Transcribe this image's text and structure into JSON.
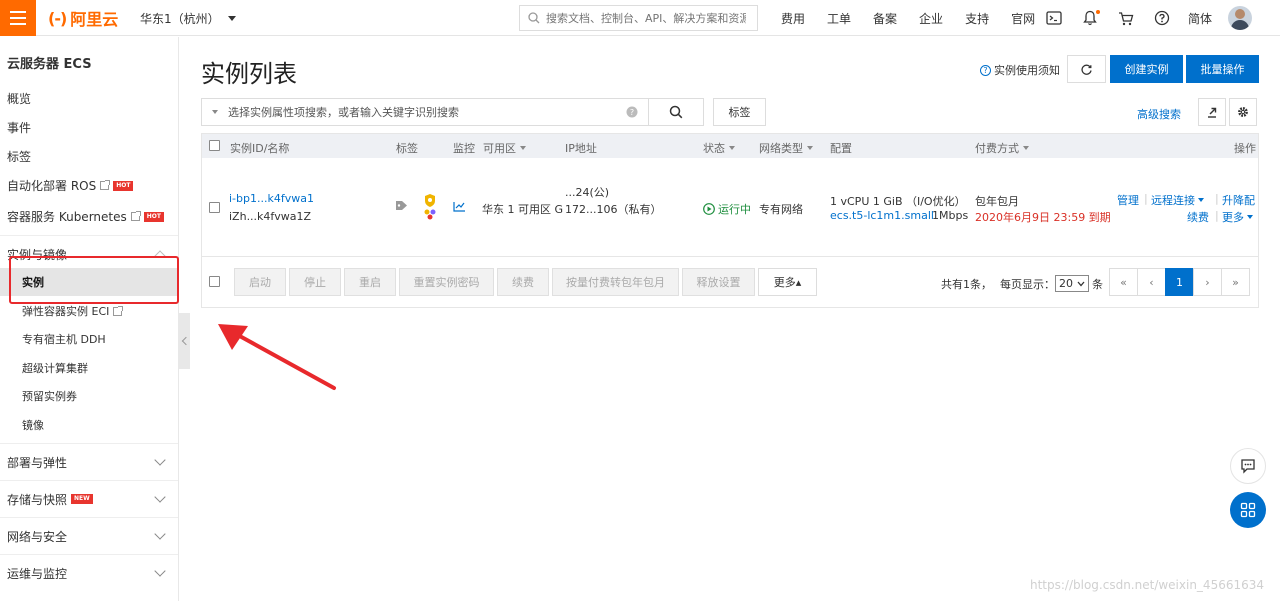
{
  "topbar": {
    "logo_mark": "(-)",
    "logo_text": "阿里云",
    "region": "华东1（杭州）",
    "search_placeholder": "搜索文档、控制台、API、解决方案和资源",
    "nav": [
      "费用",
      "工单",
      "备案",
      "企业",
      "支持",
      "官网"
    ],
    "language": "简体",
    "icons": [
      "terminal-icon",
      "bell-icon",
      "cart-icon",
      "help-icon"
    ]
  },
  "sidebar": {
    "title": "云服务器 ECS",
    "items": [
      {
        "label": "概览"
      },
      {
        "label": "事件"
      },
      {
        "label": "标签"
      },
      {
        "label": "自动化部署 ROS",
        "badge": "HOT"
      },
      {
        "label": "容器服务 Kubernetes",
        "badge": "HOT"
      }
    ],
    "section": "实例与镜像",
    "sub_items": [
      {
        "label": "实例",
        "active": true
      },
      {
        "label": "弹性容器实例 ECI"
      },
      {
        "label": "专有宿主机 DDH"
      },
      {
        "label": "超级计算集群"
      },
      {
        "label": "预留实例券"
      },
      {
        "label": "镜像"
      }
    ],
    "groups": [
      {
        "label": "部署与弹性"
      },
      {
        "label": "存储与快照",
        "badge": "NEW"
      },
      {
        "label": "网络与安全"
      },
      {
        "label": "运维与监控"
      }
    ]
  },
  "main": {
    "title": "实例列表",
    "help_link": "实例使用须知",
    "create_button": "创建实例",
    "batch_button": "批量操作",
    "filter_placeholder": "选择实例属性项搜索，或者输入关键字识别搜索",
    "tag_button": "标签",
    "advanced_search": "高级搜索"
  },
  "table": {
    "headers": {
      "id_name": "实例ID/名称",
      "tags": "标签",
      "monitor": "监控",
      "zone": "可用区",
      "ip": "IP地址",
      "status": "状态",
      "network": "网络类型",
      "config": "配置",
      "payment": "付费方式",
      "actions": "操作"
    },
    "row": {
      "id": "i-bp1...k4fvwa1",
      "name": "iZh...k4fvwa1Z",
      "zone": "华东 1 可用区 G",
      "ip_public": "...24(公)",
      "ip_private": "172...106（私有）",
      "status": "运行中",
      "network": "专有网络",
      "config_line1": "1 vCPU 1 GiB （I/O优化）",
      "config_type": "ecs.t5-lc1m1.small",
      "config_bw": "1Mbps",
      "payment_type": "包年包月",
      "expiry": "2020年6月9日 23:59 到期",
      "actions": {
        "manage": "管理",
        "remote": "远程连接",
        "upgrade": "升降配",
        "renew": "续费",
        "more": "更多"
      }
    },
    "footer_buttons": [
      "启动",
      "停止",
      "重启",
      "重置实例密码",
      "续费",
      "按量付费转包年包月",
      "释放设置"
    ],
    "more_button": "更多▴",
    "total_text": "共有1条，",
    "per_page_label": "每页显示：",
    "per_page_value": "20",
    "per_page_unit": "条",
    "pagination": [
      "«",
      "‹",
      "1",
      "›",
      "»"
    ]
  },
  "watermark": "https://blog.csdn.net/weixin_45661634",
  "colors": {
    "brand_orange": "#ff6a00",
    "primary_blue": "#0070cc",
    "annotation_red": "#e8292c"
  }
}
